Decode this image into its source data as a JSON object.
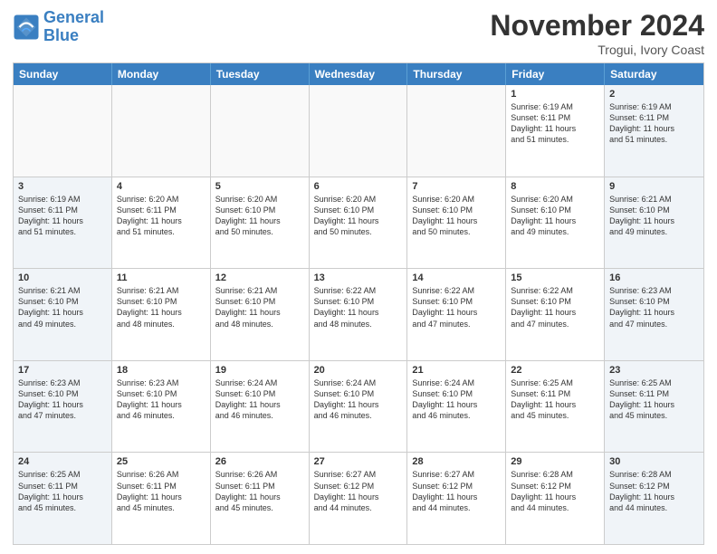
{
  "logo": {
    "line1": "General",
    "line2": "Blue"
  },
  "title": "November 2024",
  "location": "Trogui, Ivory Coast",
  "header_days": [
    "Sunday",
    "Monday",
    "Tuesday",
    "Wednesday",
    "Thursday",
    "Friday",
    "Saturday"
  ],
  "rows": [
    [
      {
        "day": "",
        "text": ""
      },
      {
        "day": "",
        "text": ""
      },
      {
        "day": "",
        "text": ""
      },
      {
        "day": "",
        "text": ""
      },
      {
        "day": "",
        "text": ""
      },
      {
        "day": "1",
        "text": "Sunrise: 6:19 AM\nSunset: 6:11 PM\nDaylight: 11 hours\nand 51 minutes."
      },
      {
        "day": "2",
        "text": "Sunrise: 6:19 AM\nSunset: 6:11 PM\nDaylight: 11 hours\nand 51 minutes."
      }
    ],
    [
      {
        "day": "3",
        "text": "Sunrise: 6:19 AM\nSunset: 6:11 PM\nDaylight: 11 hours\nand 51 minutes."
      },
      {
        "day": "4",
        "text": "Sunrise: 6:20 AM\nSunset: 6:11 PM\nDaylight: 11 hours\nand 51 minutes."
      },
      {
        "day": "5",
        "text": "Sunrise: 6:20 AM\nSunset: 6:10 PM\nDaylight: 11 hours\nand 50 minutes."
      },
      {
        "day": "6",
        "text": "Sunrise: 6:20 AM\nSunset: 6:10 PM\nDaylight: 11 hours\nand 50 minutes."
      },
      {
        "day": "7",
        "text": "Sunrise: 6:20 AM\nSunset: 6:10 PM\nDaylight: 11 hours\nand 50 minutes."
      },
      {
        "day": "8",
        "text": "Sunrise: 6:20 AM\nSunset: 6:10 PM\nDaylight: 11 hours\nand 49 minutes."
      },
      {
        "day": "9",
        "text": "Sunrise: 6:21 AM\nSunset: 6:10 PM\nDaylight: 11 hours\nand 49 minutes."
      }
    ],
    [
      {
        "day": "10",
        "text": "Sunrise: 6:21 AM\nSunset: 6:10 PM\nDaylight: 11 hours\nand 49 minutes."
      },
      {
        "day": "11",
        "text": "Sunrise: 6:21 AM\nSunset: 6:10 PM\nDaylight: 11 hours\nand 48 minutes."
      },
      {
        "day": "12",
        "text": "Sunrise: 6:21 AM\nSunset: 6:10 PM\nDaylight: 11 hours\nand 48 minutes."
      },
      {
        "day": "13",
        "text": "Sunrise: 6:22 AM\nSunset: 6:10 PM\nDaylight: 11 hours\nand 48 minutes."
      },
      {
        "day": "14",
        "text": "Sunrise: 6:22 AM\nSunset: 6:10 PM\nDaylight: 11 hours\nand 47 minutes."
      },
      {
        "day": "15",
        "text": "Sunrise: 6:22 AM\nSunset: 6:10 PM\nDaylight: 11 hours\nand 47 minutes."
      },
      {
        "day": "16",
        "text": "Sunrise: 6:23 AM\nSunset: 6:10 PM\nDaylight: 11 hours\nand 47 minutes."
      }
    ],
    [
      {
        "day": "17",
        "text": "Sunrise: 6:23 AM\nSunset: 6:10 PM\nDaylight: 11 hours\nand 47 minutes."
      },
      {
        "day": "18",
        "text": "Sunrise: 6:23 AM\nSunset: 6:10 PM\nDaylight: 11 hours\nand 46 minutes."
      },
      {
        "day": "19",
        "text": "Sunrise: 6:24 AM\nSunset: 6:10 PM\nDaylight: 11 hours\nand 46 minutes."
      },
      {
        "day": "20",
        "text": "Sunrise: 6:24 AM\nSunset: 6:10 PM\nDaylight: 11 hours\nand 46 minutes."
      },
      {
        "day": "21",
        "text": "Sunrise: 6:24 AM\nSunset: 6:10 PM\nDaylight: 11 hours\nand 46 minutes."
      },
      {
        "day": "22",
        "text": "Sunrise: 6:25 AM\nSunset: 6:11 PM\nDaylight: 11 hours\nand 45 minutes."
      },
      {
        "day": "23",
        "text": "Sunrise: 6:25 AM\nSunset: 6:11 PM\nDaylight: 11 hours\nand 45 minutes."
      }
    ],
    [
      {
        "day": "24",
        "text": "Sunrise: 6:25 AM\nSunset: 6:11 PM\nDaylight: 11 hours\nand 45 minutes."
      },
      {
        "day": "25",
        "text": "Sunrise: 6:26 AM\nSunset: 6:11 PM\nDaylight: 11 hours\nand 45 minutes."
      },
      {
        "day": "26",
        "text": "Sunrise: 6:26 AM\nSunset: 6:11 PM\nDaylight: 11 hours\nand 45 minutes."
      },
      {
        "day": "27",
        "text": "Sunrise: 6:27 AM\nSunset: 6:12 PM\nDaylight: 11 hours\nand 44 minutes."
      },
      {
        "day": "28",
        "text": "Sunrise: 6:27 AM\nSunset: 6:12 PM\nDaylight: 11 hours\nand 44 minutes."
      },
      {
        "day": "29",
        "text": "Sunrise: 6:28 AM\nSunset: 6:12 PM\nDaylight: 11 hours\nand 44 minutes."
      },
      {
        "day": "30",
        "text": "Sunrise: 6:28 AM\nSunset: 6:12 PM\nDaylight: 11 hours\nand 44 minutes."
      }
    ]
  ]
}
